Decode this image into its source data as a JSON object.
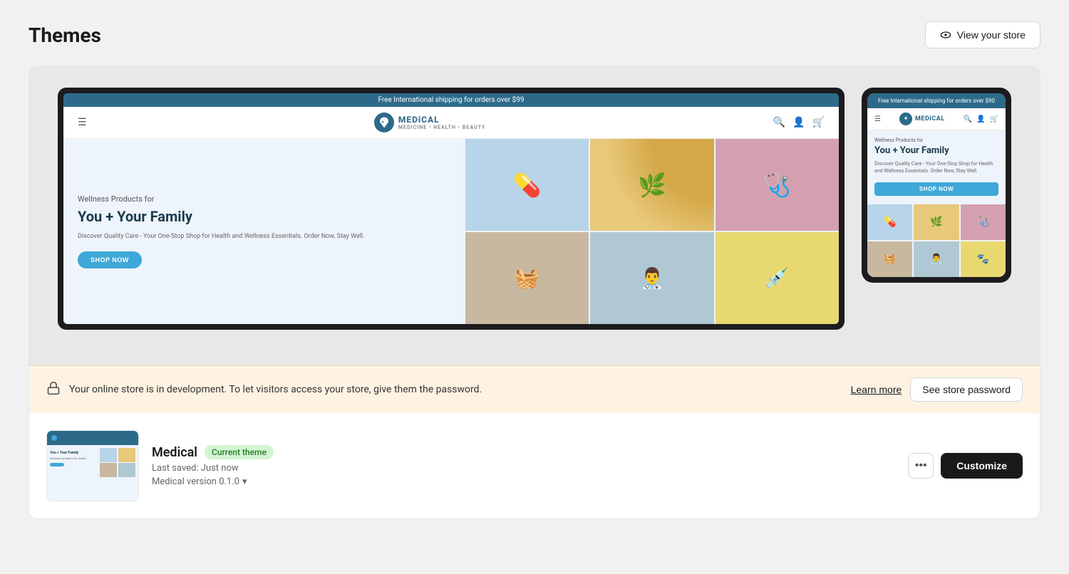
{
  "page": {
    "title": "Themes"
  },
  "header": {
    "view_store_label": "View your store"
  },
  "preview": {
    "desktop": {
      "topbar": "Free International shipping for orders over $99",
      "nav": {
        "brand": "MEDiCAL",
        "tagline": "MEDICINE • HEALTH • BEAUTY"
      },
      "hero": {
        "subtitle": "Wellness Products for",
        "title": "You + Your Family",
        "description": "Discover Quality Care - Your One-Stop Shop for Health and Wellness Essentials. Order Now, Stay Well.",
        "cta": "SHOP NOW"
      }
    },
    "mobile": {
      "topbar": "Free International shipping for orders over $90",
      "nav": {
        "brand": "MEDiCAL"
      },
      "hero": {
        "subtitle": "Wellness Products for",
        "title": "You + Your Family",
        "description": "Discover Quality Care - Your One-Stop Shop for Health and Wellness Essentials. Order Now, Stay Well.",
        "cta": "SHOP NOW"
      }
    }
  },
  "notice": {
    "text": "Your online store is in development. To let visitors access your store, give them the password.",
    "learn_more": "Learn more",
    "see_password": "See store password"
  },
  "theme": {
    "name": "Medical",
    "badge": "Current theme",
    "saved": "Last saved: Just now",
    "version": "Medical version 0.1.0",
    "customize_label": "Customize"
  }
}
